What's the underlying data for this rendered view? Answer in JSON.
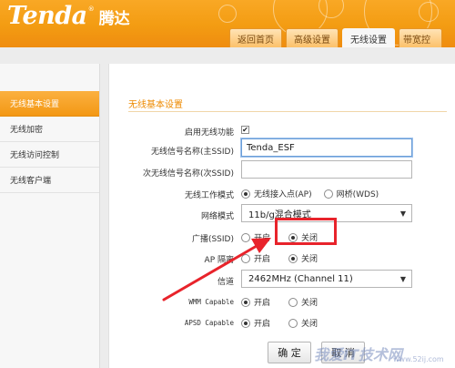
{
  "brand": {
    "logo_en": "Tenda",
    "logo_reg": "®",
    "logo_cn": "腾达",
    "accent": "#f39c12"
  },
  "nav_tabs": [
    {
      "label": "返回首页",
      "active": false
    },
    {
      "label": "高级设置",
      "active": false
    },
    {
      "label": "无线设置",
      "active": true
    },
    {
      "label": "带宽控",
      "active": false
    }
  ],
  "sidebar": {
    "items": [
      {
        "label": "无线基本设置",
        "active": true
      },
      {
        "label": "无线加密",
        "active": false
      },
      {
        "label": "无线访问控制",
        "active": false
      },
      {
        "label": "无线客户端",
        "active": false
      }
    ]
  },
  "section": {
    "title": "无线基本设置"
  },
  "form": {
    "enable_wireless": {
      "label": "启用无线功能",
      "checked": true,
      "mark": "✔"
    },
    "primary_ssid": {
      "label": "无线信号名称(主SSID)",
      "value": "Tenda_ESF"
    },
    "secondary_ssid": {
      "label": "次无线信号名称(次SSID)",
      "value": ""
    },
    "work_mode": {
      "label": "无线工作模式",
      "options": [
        "无线接入点(AP)",
        "网桥(WDS)"
      ],
      "selected": 0
    },
    "network_mode": {
      "label": "网络模式",
      "value": "11b/g混合模式"
    },
    "broadcast": {
      "label": "广播(SSID)",
      "options": [
        "开启",
        "关闭"
      ],
      "selected": 1
    },
    "ap_isolation": {
      "label": "AP 隔离",
      "options": [
        "开启",
        "关闭"
      ],
      "selected": 1
    },
    "channel": {
      "label": "信道",
      "value": "2462MHz (Channel 11)"
    },
    "wmm": {
      "label": "WMM Capable",
      "options": [
        "开启",
        "关闭"
      ],
      "selected": 0
    },
    "apsd": {
      "label": "APSD Capable",
      "options": [
        "开启",
        "关闭"
      ],
      "selected": 0
    }
  },
  "buttons": {
    "confirm": "确 定",
    "cancel": "取 消"
  },
  "annotation": {
    "highlight_color": "#e8232b"
  },
  "watermark": {
    "text": "我爱IT技术网",
    "url": "www.52ij.com"
  }
}
